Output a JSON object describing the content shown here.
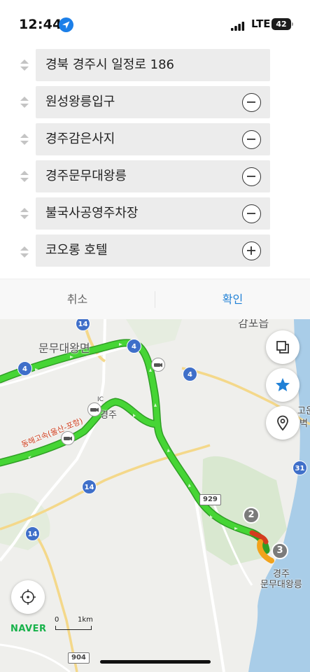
{
  "status": {
    "time": "12:44",
    "network": "LTE",
    "battery": "42",
    "icons": [
      "location-arrow-icon",
      "signal-icon",
      "battery-icon"
    ]
  },
  "route": {
    "waypoints": [
      {
        "label": "경북 경주시 일정로 186",
        "action": "none"
      },
      {
        "label": "원성왕릉입구",
        "action": "remove"
      },
      {
        "label": "경주감은사지",
        "action": "remove"
      },
      {
        "label": "경주문무대왕릉",
        "action": "remove"
      },
      {
        "label": "불국사공영주차장",
        "action": "remove"
      },
      {
        "label": "코오롱 호텔",
        "action": "add"
      }
    ]
  },
  "actions": {
    "cancel": "취소",
    "confirm": "확인"
  },
  "map": {
    "labels": {
      "munmu_top": "문무대왕면",
      "gamposi": "감포읍",
      "ic": "IC",
      "gyeongju_ic": "경주",
      "expressway": "동해고속(울산-포항)",
      "gyeongju_dest": "경주",
      "munmu_dest": "문무대왕릉",
      "side1": "고운",
      "side2": "벽"
    },
    "road_shields": [
      "14",
      "4",
      "4",
      "4",
      "14",
      "14",
      "31"
    ],
    "road_boxes": [
      "929",
      "904"
    ],
    "markers": [
      "2",
      "3"
    ],
    "brand": "NAVER",
    "scale_zero": "0",
    "scale_distance": "1km",
    "route_color": "#3fcc2f",
    "accent": "#1f80d6"
  }
}
